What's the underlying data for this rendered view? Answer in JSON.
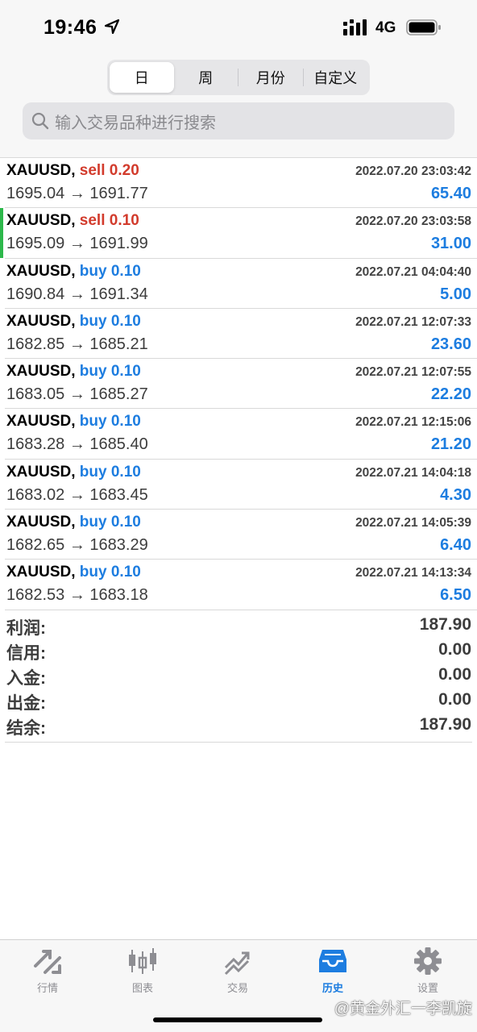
{
  "status_bar": {
    "time": "19:46",
    "network": "4G"
  },
  "segments": [
    "日",
    "周",
    "月份",
    "自定义"
  ],
  "search": {
    "placeholder": "输入交易品种进行搜索"
  },
  "trades": [
    {
      "symbol": "XAUUSD,",
      "side": "sell",
      "volume": "0.20",
      "open": "1695.04",
      "arrow": "→",
      "close": "1691.77",
      "datetime": "2022.07.20 23:03:42",
      "profit": "65.40"
    },
    {
      "symbol": "XAUUSD,",
      "side": "sell",
      "volume": "0.10",
      "open": "1695.09",
      "arrow": "→",
      "close": "1691.99",
      "datetime": "2022.07.20 23:03:58",
      "profit": "31.00"
    },
    {
      "symbol": "XAUUSD,",
      "side": "buy",
      "volume": "0.10",
      "open": "1690.84",
      "arrow": "→",
      "close": "1691.34",
      "datetime": "2022.07.21 04:04:40",
      "profit": "5.00"
    },
    {
      "symbol": "XAUUSD,",
      "side": "buy",
      "volume": "0.10",
      "open": "1682.85",
      "arrow": "→",
      "close": "1685.21",
      "datetime": "2022.07.21 12:07:33",
      "profit": "23.60"
    },
    {
      "symbol": "XAUUSD,",
      "side": "buy",
      "volume": "0.10",
      "open": "1683.05",
      "arrow": "→",
      "close": "1685.27",
      "datetime": "2022.07.21 12:07:55",
      "profit": "22.20"
    },
    {
      "symbol": "XAUUSD,",
      "side": "buy",
      "volume": "0.10",
      "open": "1683.28",
      "arrow": "→",
      "close": "1685.40",
      "datetime": "2022.07.21 12:15:06",
      "profit": "21.20"
    },
    {
      "symbol": "XAUUSD,",
      "side": "buy",
      "volume": "0.10",
      "open": "1683.02",
      "arrow": "→",
      "close": "1683.45",
      "datetime": "2022.07.21 14:04:18",
      "profit": "4.30"
    },
    {
      "symbol": "XAUUSD,",
      "side": "buy",
      "volume": "0.10",
      "open": "1682.65",
      "arrow": "→",
      "close": "1683.29",
      "datetime": "2022.07.21 14:05:39",
      "profit": "6.40"
    },
    {
      "symbol": "XAUUSD,",
      "side": "buy",
      "volume": "0.10",
      "open": "1682.53",
      "arrow": "→",
      "close": "1683.18",
      "datetime": "2022.07.21 14:13:34",
      "profit": "6.50"
    }
  ],
  "summary": [
    {
      "label": "利润:",
      "value": "187.90"
    },
    {
      "label": "信用:",
      "value": "0.00"
    },
    {
      "label": "入金:",
      "value": "0.00"
    },
    {
      "label": "出金:",
      "value": "0.00"
    },
    {
      "label": "结余:",
      "value": "187.90"
    }
  ],
  "tabs": [
    {
      "label": "行情",
      "icon": "quotes-icon"
    },
    {
      "label": "图表",
      "icon": "chart-icon"
    },
    {
      "label": "交易",
      "icon": "trade-icon"
    },
    {
      "label": "历史",
      "icon": "history-icon"
    },
    {
      "label": "设置",
      "icon": "settings-icon"
    }
  ],
  "watermark": "@黄金外汇一李凯旋",
  "colors": {
    "sell": "#d23b2c",
    "buy": "#1d7de0",
    "accent": "#1d7de0",
    "marker": "#2db84b"
  }
}
